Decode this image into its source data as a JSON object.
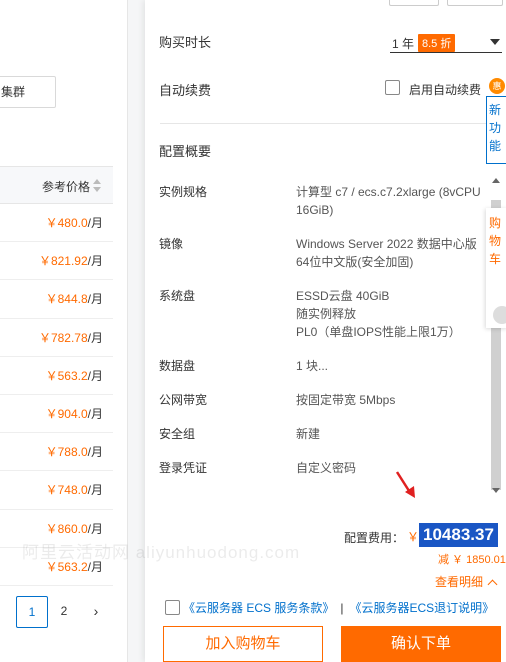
{
  "left_table": {
    "search_value": "集群",
    "price_header": "参考价格",
    "rows": [
      {
        "currency": "￥",
        "price": "480.0",
        "unit": "/月"
      },
      {
        "currency": "￥",
        "price": "821.92",
        "unit": "/月"
      },
      {
        "currency": "￥",
        "price": "844.8",
        "unit": "/月"
      },
      {
        "currency": "￥",
        "price": "782.78",
        "unit": "/月"
      },
      {
        "currency": "￥",
        "price": "563.2",
        "unit": "/月"
      },
      {
        "currency": "￥",
        "price": "904.0",
        "unit": "/月"
      },
      {
        "currency": "￥",
        "price": "788.0",
        "unit": "/月"
      },
      {
        "currency": "￥",
        "price": "748.0",
        "unit": "/月"
      },
      {
        "currency": "￥",
        "price": "860.0",
        "unit": "/月"
      },
      {
        "currency": "￥",
        "price": "563.2",
        "unit": "/月"
      }
    ],
    "pager": {
      "current": "1",
      "next_page": "2",
      "next_icon": "›"
    }
  },
  "panel": {
    "duration_label": "购买时长",
    "duration_value": "1 年",
    "duration_discount": "8.5 折",
    "auto_renew_label": "自动续费",
    "auto_renew_option": "启用自动续费",
    "auto_renew_badge": "惠",
    "summary_title": "配置概要",
    "specs": [
      {
        "k": "实例规格",
        "v": "计算型 c7 / ecs.c7.2xlarge (8vCPU 16GiB)"
      },
      {
        "k": "镜像",
        "v": "Windows Server 2022 数据中心版 64位中文版(安全加固)"
      },
      {
        "k": "系统盘",
        "v": "ESSD云盘 40GiB\n随实例释放\nPL0（单盘IOPS性能上限1万）"
      },
      {
        "k": "数据盘",
        "v": "1 块..."
      },
      {
        "k": "公网带宽",
        "v": "按固定带宽 5Mbps"
      },
      {
        "k": "安全组",
        "v": "新建"
      },
      {
        "k": "登录凭证",
        "v": "自定义密码"
      }
    ],
    "footer": {
      "fee_label": "配置费用：",
      "fee_currency": "￥",
      "fee_value": "10483.37",
      "fee_save": "减 ￥ 1850.01",
      "fee_detail": "查看明细",
      "terms1": "《云服务器 ECS 服务条款》",
      "terms_sep": "|",
      "terms2": "《云服务器ECS退订说明》",
      "cart_button": "加入购物车",
      "order_button": "确认下单"
    }
  },
  "side_widgets": {
    "blue_text": "新功能",
    "orange_text": "购物车"
  },
  "watermark": "阿里云活动网 aliyunhuodong.com",
  "colors": {
    "accent": "#ff6a00",
    "link": "#0070cc",
    "highlight": "#1a56c4"
  }
}
